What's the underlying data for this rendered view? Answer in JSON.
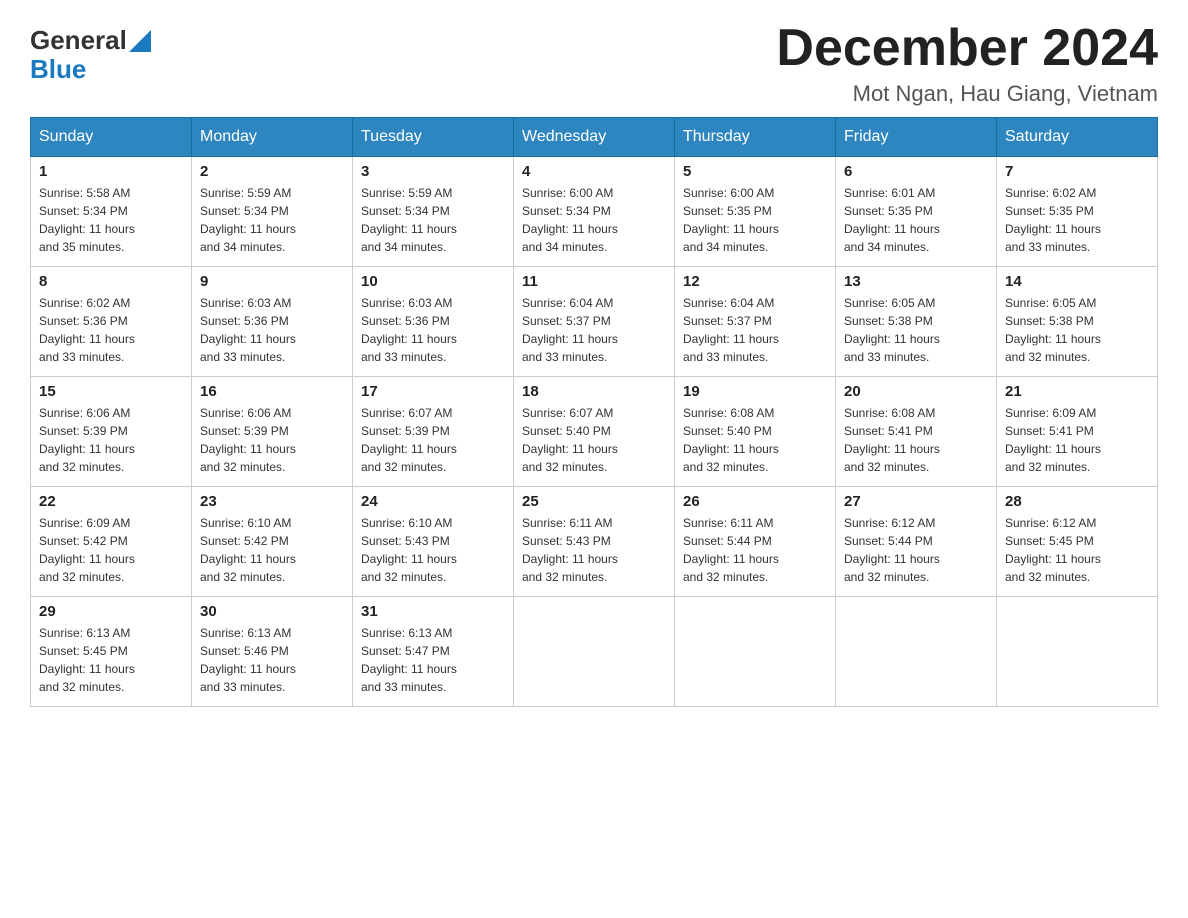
{
  "header": {
    "logo_general": "General",
    "logo_blue": "Blue",
    "month_year": "December 2024",
    "location": "Mot Ngan, Hau Giang, Vietnam"
  },
  "days_of_week": [
    "Sunday",
    "Monday",
    "Tuesday",
    "Wednesday",
    "Thursday",
    "Friday",
    "Saturday"
  ],
  "weeks": [
    [
      {
        "num": "1",
        "sunrise": "5:58 AM",
        "sunset": "5:34 PM",
        "daylight": "11 hours and 35 minutes."
      },
      {
        "num": "2",
        "sunrise": "5:59 AM",
        "sunset": "5:34 PM",
        "daylight": "11 hours and 34 minutes."
      },
      {
        "num": "3",
        "sunrise": "5:59 AM",
        "sunset": "5:34 PM",
        "daylight": "11 hours and 34 minutes."
      },
      {
        "num": "4",
        "sunrise": "6:00 AM",
        "sunset": "5:34 PM",
        "daylight": "11 hours and 34 minutes."
      },
      {
        "num": "5",
        "sunrise": "6:00 AM",
        "sunset": "5:35 PM",
        "daylight": "11 hours and 34 minutes."
      },
      {
        "num": "6",
        "sunrise": "6:01 AM",
        "sunset": "5:35 PM",
        "daylight": "11 hours and 34 minutes."
      },
      {
        "num": "7",
        "sunrise": "6:02 AM",
        "sunset": "5:35 PM",
        "daylight": "11 hours and 33 minutes."
      }
    ],
    [
      {
        "num": "8",
        "sunrise": "6:02 AM",
        "sunset": "5:36 PM",
        "daylight": "11 hours and 33 minutes."
      },
      {
        "num": "9",
        "sunrise": "6:03 AM",
        "sunset": "5:36 PM",
        "daylight": "11 hours and 33 minutes."
      },
      {
        "num": "10",
        "sunrise": "6:03 AM",
        "sunset": "5:36 PM",
        "daylight": "11 hours and 33 minutes."
      },
      {
        "num": "11",
        "sunrise": "6:04 AM",
        "sunset": "5:37 PM",
        "daylight": "11 hours and 33 minutes."
      },
      {
        "num": "12",
        "sunrise": "6:04 AM",
        "sunset": "5:37 PM",
        "daylight": "11 hours and 33 minutes."
      },
      {
        "num": "13",
        "sunrise": "6:05 AM",
        "sunset": "5:38 PM",
        "daylight": "11 hours and 33 minutes."
      },
      {
        "num": "14",
        "sunrise": "6:05 AM",
        "sunset": "5:38 PM",
        "daylight": "11 hours and 32 minutes."
      }
    ],
    [
      {
        "num": "15",
        "sunrise": "6:06 AM",
        "sunset": "5:39 PM",
        "daylight": "11 hours and 32 minutes."
      },
      {
        "num": "16",
        "sunrise": "6:06 AM",
        "sunset": "5:39 PM",
        "daylight": "11 hours and 32 minutes."
      },
      {
        "num": "17",
        "sunrise": "6:07 AM",
        "sunset": "5:39 PM",
        "daylight": "11 hours and 32 minutes."
      },
      {
        "num": "18",
        "sunrise": "6:07 AM",
        "sunset": "5:40 PM",
        "daylight": "11 hours and 32 minutes."
      },
      {
        "num": "19",
        "sunrise": "6:08 AM",
        "sunset": "5:40 PM",
        "daylight": "11 hours and 32 minutes."
      },
      {
        "num": "20",
        "sunrise": "6:08 AM",
        "sunset": "5:41 PM",
        "daylight": "11 hours and 32 minutes."
      },
      {
        "num": "21",
        "sunrise": "6:09 AM",
        "sunset": "5:41 PM",
        "daylight": "11 hours and 32 minutes."
      }
    ],
    [
      {
        "num": "22",
        "sunrise": "6:09 AM",
        "sunset": "5:42 PM",
        "daylight": "11 hours and 32 minutes."
      },
      {
        "num": "23",
        "sunrise": "6:10 AM",
        "sunset": "5:42 PM",
        "daylight": "11 hours and 32 minutes."
      },
      {
        "num": "24",
        "sunrise": "6:10 AM",
        "sunset": "5:43 PM",
        "daylight": "11 hours and 32 minutes."
      },
      {
        "num": "25",
        "sunrise": "6:11 AM",
        "sunset": "5:43 PM",
        "daylight": "11 hours and 32 minutes."
      },
      {
        "num": "26",
        "sunrise": "6:11 AM",
        "sunset": "5:44 PM",
        "daylight": "11 hours and 32 minutes."
      },
      {
        "num": "27",
        "sunrise": "6:12 AM",
        "sunset": "5:44 PM",
        "daylight": "11 hours and 32 minutes."
      },
      {
        "num": "28",
        "sunrise": "6:12 AM",
        "sunset": "5:45 PM",
        "daylight": "11 hours and 32 minutes."
      }
    ],
    [
      {
        "num": "29",
        "sunrise": "6:13 AM",
        "sunset": "5:45 PM",
        "daylight": "11 hours and 32 minutes."
      },
      {
        "num": "30",
        "sunrise": "6:13 AM",
        "sunset": "5:46 PM",
        "daylight": "11 hours and 33 minutes."
      },
      {
        "num": "31",
        "sunrise": "6:13 AM",
        "sunset": "5:47 PM",
        "daylight": "11 hours and 33 minutes."
      },
      null,
      null,
      null,
      null
    ]
  ],
  "labels": {
    "sunrise": "Sunrise: ",
    "sunset": "Sunset: ",
    "daylight": "Daylight: "
  }
}
